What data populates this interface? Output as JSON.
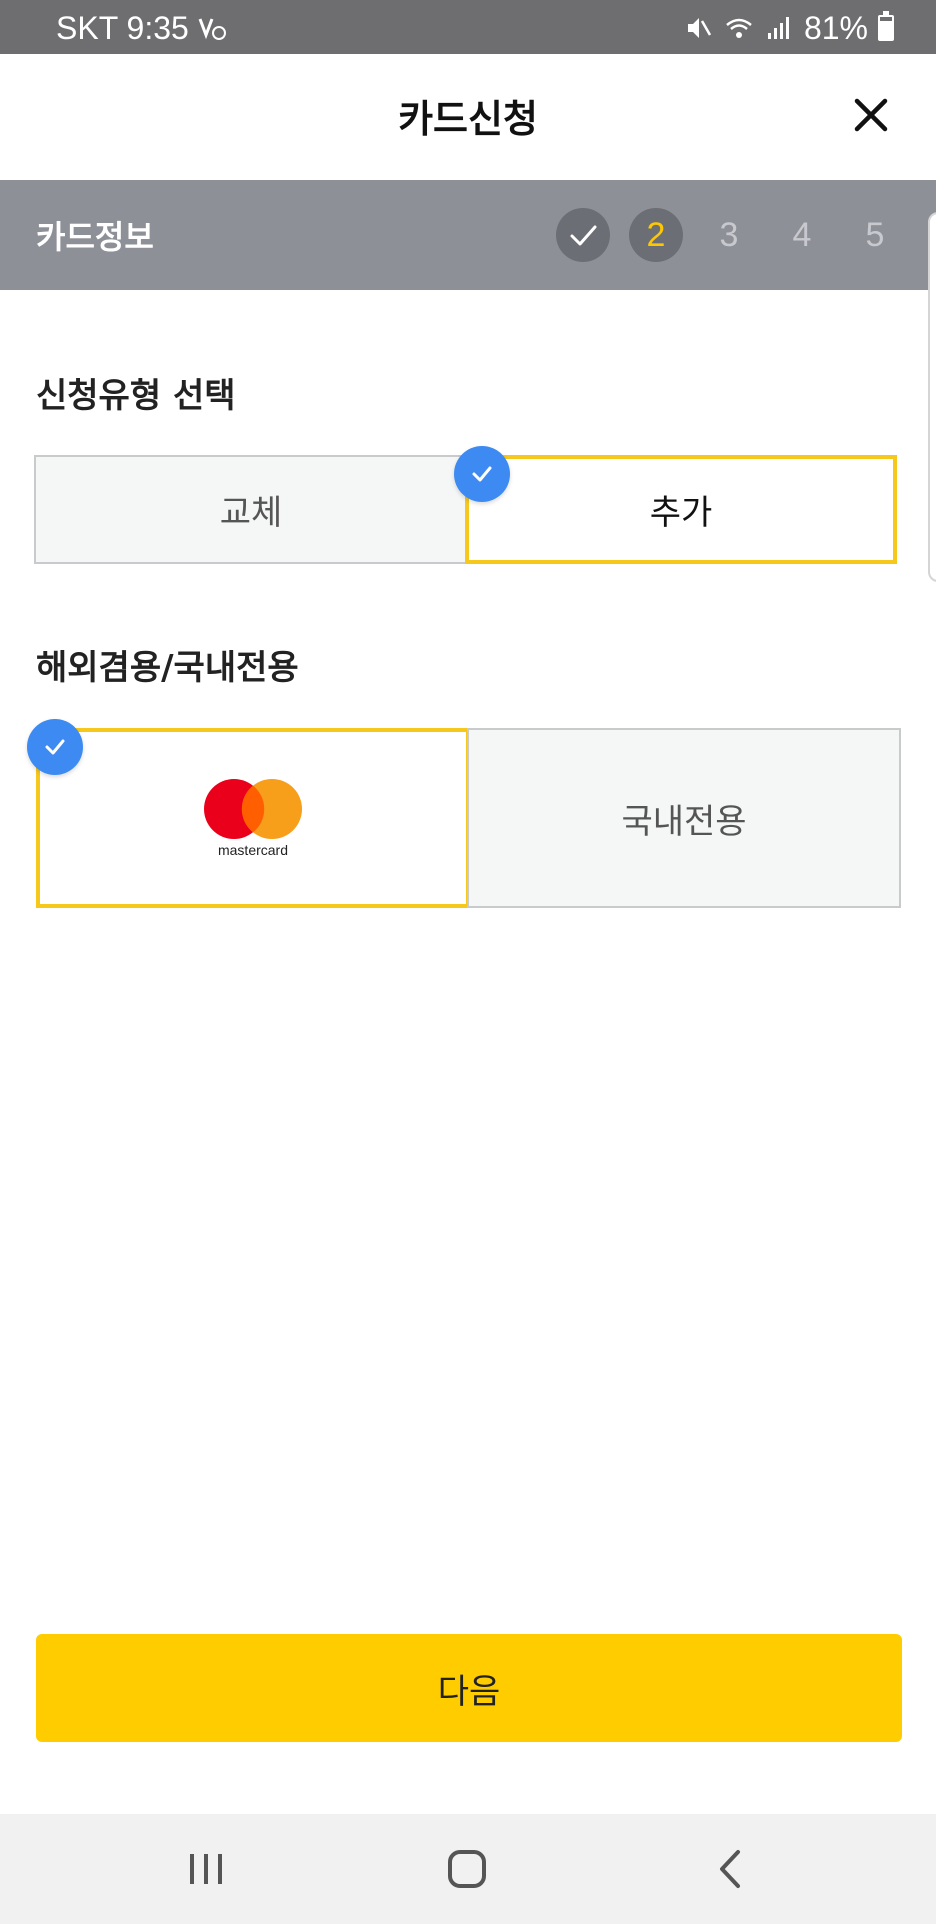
{
  "status_bar": {
    "carrier_time": "SKT 9:35",
    "battery": "81%",
    "battery_level": 0.81
  },
  "header": {
    "title": "카드신청",
    "close_icon": "close-icon"
  },
  "steps": {
    "title": "카드정보",
    "items": [
      {
        "label": "",
        "state": "done"
      },
      {
        "label": "2",
        "state": "current"
      },
      {
        "label": "3",
        "state": "upcoming"
      },
      {
        "label": "4",
        "state": "upcoming"
      },
      {
        "label": "5",
        "state": "upcoming"
      }
    ]
  },
  "application_type": {
    "title": "신청유형 선택",
    "options": [
      {
        "label": "교체",
        "selected": false
      },
      {
        "label": "추가",
        "selected": true
      }
    ]
  },
  "usage_type": {
    "title": "해외겸용/국내전용",
    "options": [
      {
        "label": "mastercard",
        "selected": true
      },
      {
        "label": "국내전용",
        "selected": false
      }
    ]
  },
  "next_button": {
    "label": "다음"
  },
  "colors": {
    "accent_yellow": "#ffcc00",
    "selected_border": "#f6c81c",
    "check_blue": "#3d8bf2",
    "step_bar": "#8e9098"
  }
}
